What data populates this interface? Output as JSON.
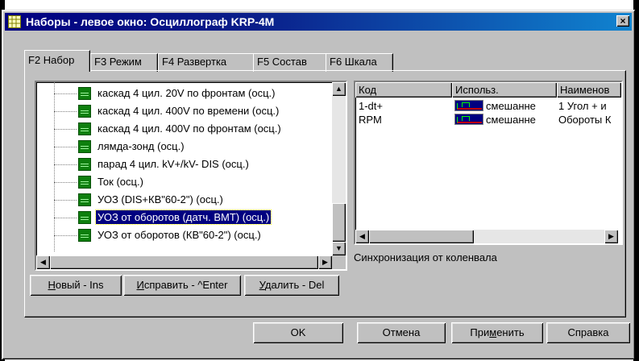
{
  "window": {
    "title": "Наборы - левое окно: Осциллограф KRP-4M",
    "close_label": "×"
  },
  "tabs": [
    {
      "label": "F2 Набор",
      "active": true
    },
    {
      "label": "F3 Режим",
      "active": false
    },
    {
      "label": "F4 Развертка",
      "active": false
    },
    {
      "label": "F5 Состав",
      "active": false
    },
    {
      "label": "F6 Шкала",
      "active": false
    }
  ],
  "tree": {
    "items": [
      {
        "label": "каскад 4 цил. 20V по фронтам (осц.)",
        "selected": false
      },
      {
        "label": "каскад 4 цил. 400V по времени (осц.)",
        "selected": false
      },
      {
        "label": "каскад 4 цил. 400V по фронтам (осц.)",
        "selected": false
      },
      {
        "label": "лямда-зонд (осц.)",
        "selected": false
      },
      {
        "label": "парад 4 цил. kV+/kV- DIS (осц.)",
        "selected": false
      },
      {
        "label": "Ток (осц.)",
        "selected": false
      },
      {
        "label": "УОЗ (DIS+КВ\"60-2\") (осц.)",
        "selected": false
      },
      {
        "label": "УОЗ от оборотов (датч. ВМТ) (осц.)",
        "selected": true
      },
      {
        "label": "УОЗ от оборотов (КВ\"60-2\") (осц.)",
        "selected": false
      }
    ]
  },
  "list": {
    "headers": [
      "Код",
      "Использ.",
      "Наименов"
    ],
    "rows": [
      {
        "code": "1-dt+",
        "usage": "смешанне",
        "name": "1 Угол + и"
      },
      {
        "code": "RPM",
        "usage": "смешанне",
        "name": "Обороты К"
      }
    ]
  },
  "status_text": "Синхронизация от коленвала",
  "actions": {
    "new": {
      "u": "Н",
      "rest": "овый - Ins"
    },
    "edit": {
      "u": "И",
      "rest": "справить - ^Enter"
    },
    "delete": {
      "u": "У",
      "rest": "далить - Del"
    }
  },
  "footer": {
    "ok": "OK",
    "cancel": "Отмена",
    "apply_pre": "При",
    "apply_u": "м",
    "apply_post": "енить",
    "help": "Справка"
  },
  "colors": {
    "title_start": "#000080",
    "title_end": "#1084d0",
    "selection": "#000080",
    "icon_green": "#0e7f0e"
  },
  "icons": {
    "title": "grid-icon",
    "tree_item": "oscillograph-icon",
    "usage": "waveform-icon"
  }
}
